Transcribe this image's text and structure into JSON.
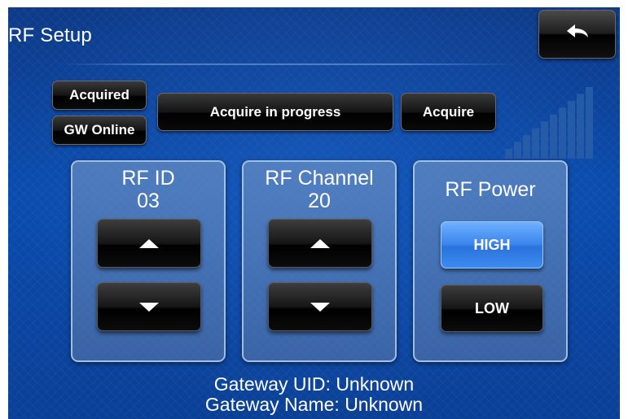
{
  "header": {
    "title": "RF Setup",
    "back_icon": "back-arrow-icon"
  },
  "status": {
    "acquired_label": "Acquired",
    "gw_online_label": "GW Online",
    "acquire_progress_label": "Acquire in progress",
    "acquire_label": "Acquire"
  },
  "signal": {
    "icon": "signal-strength-icon",
    "bars_total": 10,
    "colors": {
      "bar": "#2a5ea6"
    }
  },
  "rf_id": {
    "label": "RF ID",
    "value": "03",
    "up_icon": "arrow-up-icon",
    "down_icon": "arrow-down-icon"
  },
  "rf_channel": {
    "label": "RF Channel",
    "value": "20",
    "up_icon": "arrow-up-icon",
    "down_icon": "arrow-down-icon"
  },
  "rf_power": {
    "label": "RF Power",
    "high_label": "HIGH",
    "low_label": "LOW",
    "selected": "HIGH",
    "colors": {
      "selected": "#3b86ee"
    }
  },
  "gateway": {
    "uid_line": "Gateway UID: Unknown",
    "name_line": "Gateway Name: Unknown"
  }
}
